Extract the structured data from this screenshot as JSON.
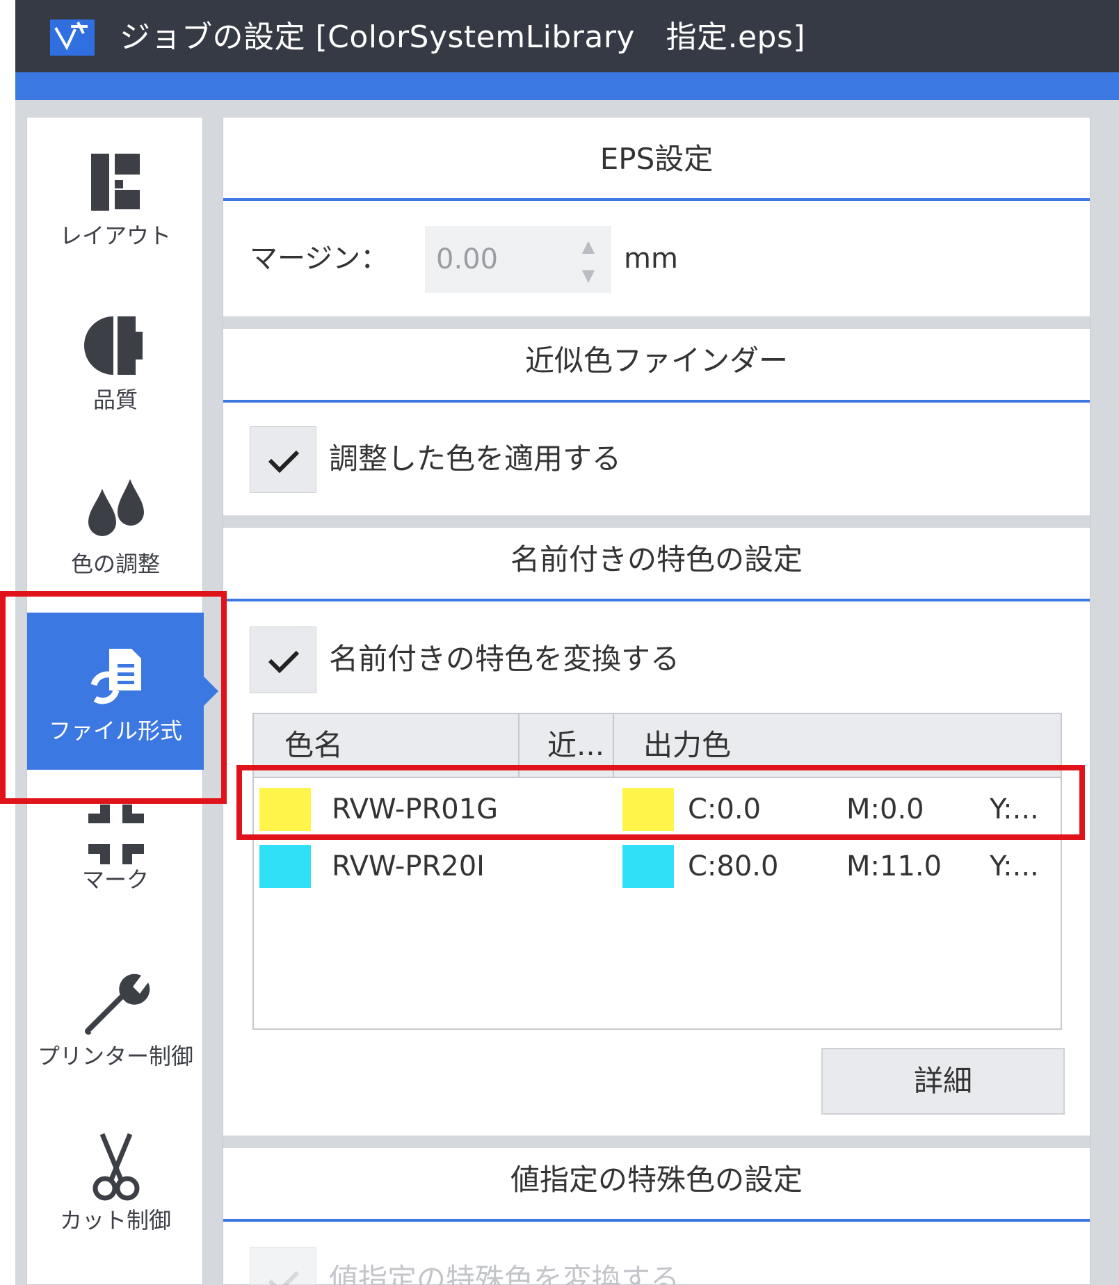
{
  "window": {
    "title": "ジョブの設定 [ColorSystemLibrary　指定.eps]"
  },
  "sidebar": {
    "items": [
      {
        "label": "レイアウト",
        "icon": "layout-icon"
      },
      {
        "label": "品質",
        "icon": "quality-icon"
      },
      {
        "label": "色の調整",
        "icon": "color-drops-icon"
      },
      {
        "label": "ファイル形式",
        "icon": "file-convert-icon",
        "active": true
      },
      {
        "label": "マーク",
        "icon": "crop-marks-icon"
      },
      {
        "label": "プリンター制御",
        "icon": "wrench-icon"
      },
      {
        "label": "カット制御",
        "icon": "scissors-icon"
      }
    ]
  },
  "eps": {
    "header": "EPS設定",
    "margin_label": "マージン：",
    "margin_value": "0.00",
    "margin_unit": "mm"
  },
  "finder": {
    "header": "近似色ファインダー",
    "apply_label": "調整した色を適用する",
    "apply_checked": true
  },
  "named_spot": {
    "header": "名前付きの特色の設定",
    "convert_label": "名前付きの特色を変換する",
    "convert_checked": true,
    "columns": [
      "色名",
      "近...",
      "出力色"
    ],
    "rows": [
      {
        "name": "RVW-PR01G",
        "swatch": "#fff44a",
        "out_swatch": "#fff44a",
        "c": "C:0.0",
        "m": "M:0.0",
        "y": "Y:..."
      },
      {
        "name": "RVW-PR20I",
        "swatch": "#2fe0f7",
        "out_swatch": "#2fe0f7",
        "c": "C:80.0",
        "m": "M:11.0",
        "y": "Y:..."
      }
    ],
    "detail_button": "詳細"
  },
  "value_spot": {
    "header": "値指定の特殊色の設定",
    "convert_label": "値指定の特殊色を変換する"
  },
  "colors": {
    "accent": "#3c78e2",
    "titlebar": "#363a44",
    "highlight": "#e0131a"
  }
}
